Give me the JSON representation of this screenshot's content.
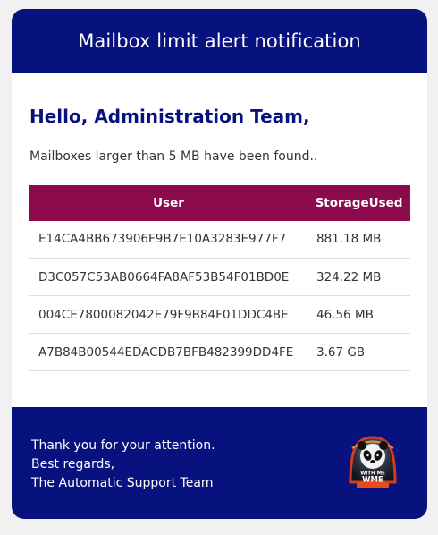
{
  "header": {
    "title": "Mailbox limit alert notification"
  },
  "content": {
    "greeting": "Hello, Administration Team,",
    "intro": "Mailboxes larger than 5 MB have been found.."
  },
  "table": {
    "columns": [
      "User",
      "StorageUsed"
    ],
    "rows": [
      [
        "E14CA4BB673906F9B7E10A3283E977F7",
        "881.18 MB"
      ],
      [
        "D3C057C53AB0664FA8AF53B54F01BD0E",
        "324.22 MB"
      ],
      [
        "004CE7800082042E79F9B84F01DDC4BE",
        "46.56 MB"
      ],
      [
        "A7B84B00544EDACDB7BFB482399DD4FE",
        "3.67 GB"
      ]
    ]
  },
  "footer": {
    "lines": [
      "Thank you for your attention.",
      "Best regards,",
      "The Automatic Support Team"
    ],
    "logo_text": "WITH ME WME",
    "logo_icon": "panda-logo-icon"
  },
  "colors": {
    "brand": "#08127f",
    "table_header": "#8b0b4c"
  }
}
